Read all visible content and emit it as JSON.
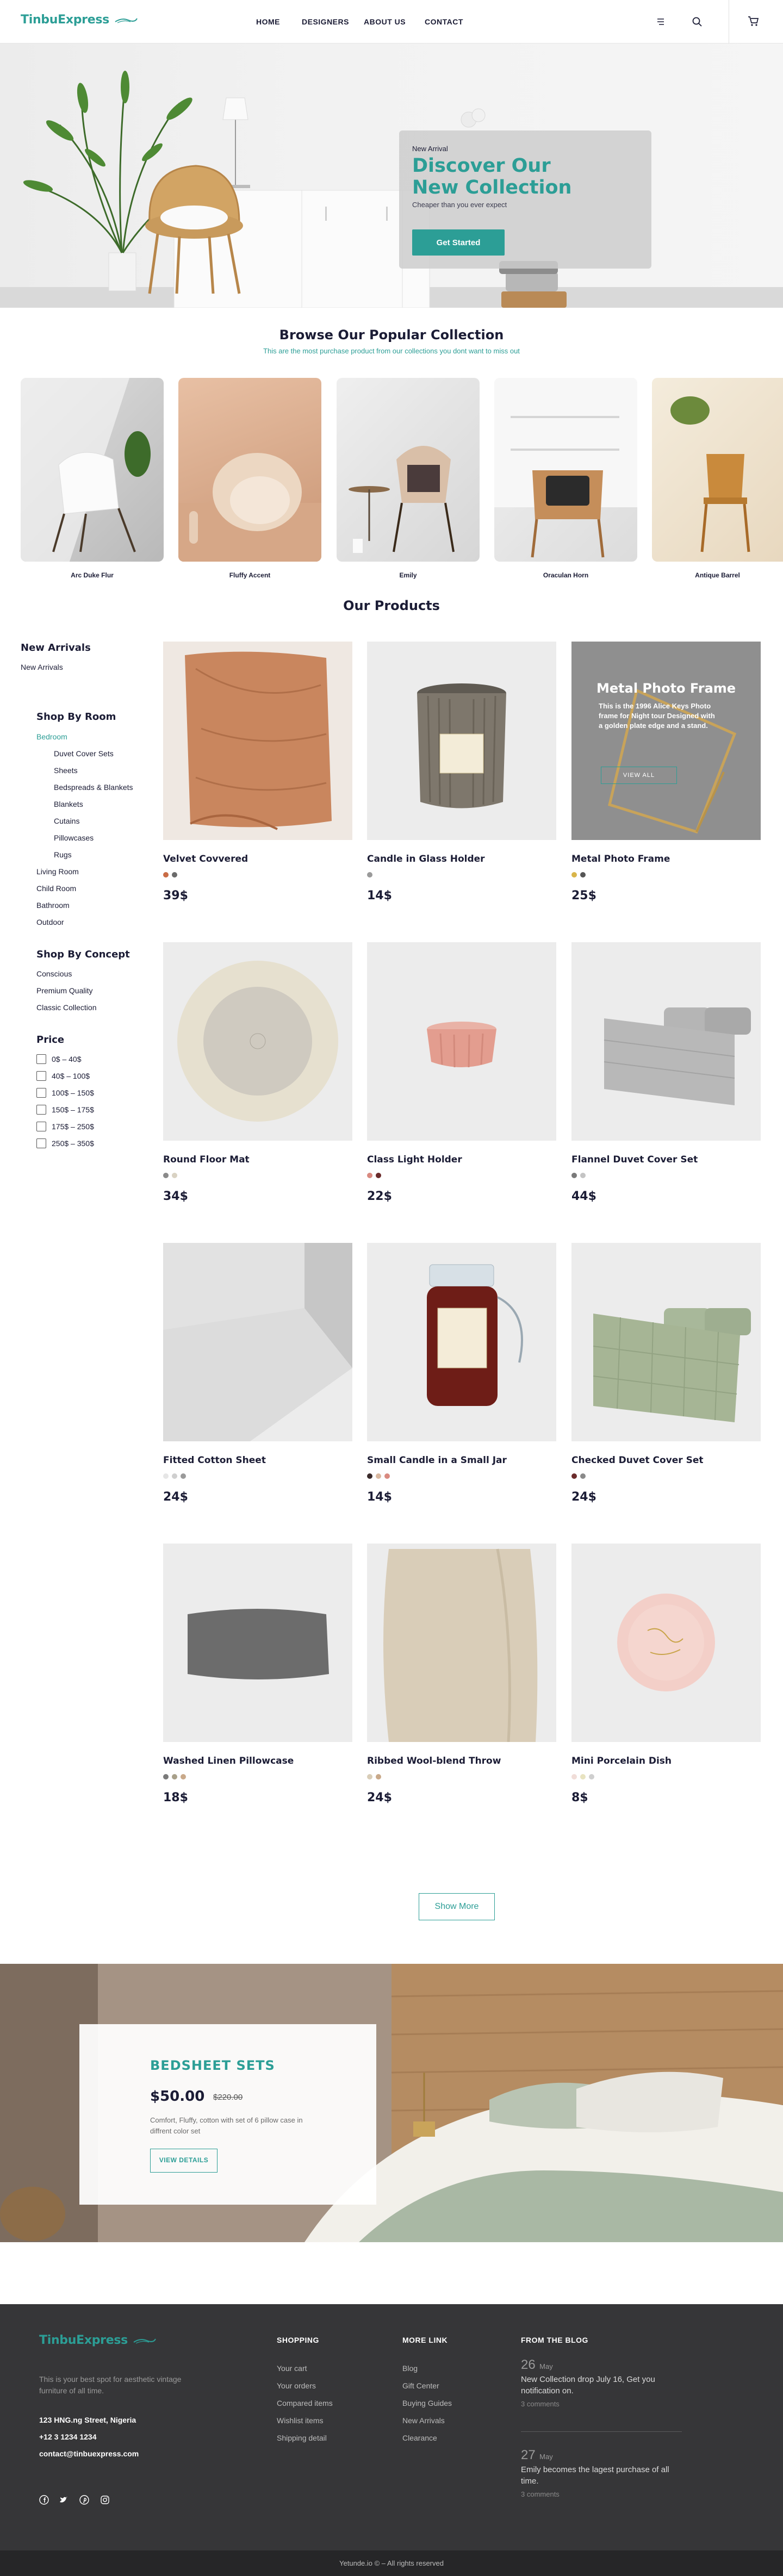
{
  "header": {
    "logo": "TinbuExpress",
    "nav": [
      "HOME",
      "DESIGNERS",
      "ABOUT US",
      "CONTACT"
    ]
  },
  "hero": {
    "kicker": "New Arrival",
    "title_line1": "Discover Our",
    "title_line2": "New Collection",
    "subtitle": "Cheaper than you ever expect",
    "cta": "Get Started"
  },
  "collection": {
    "title": "Browse Our Popular Collection",
    "subtitle": "This are the most purchase product from our collections you dont want to miss out",
    "items": [
      "Arc Duke Flur",
      "Fluffy Accent",
      "Emily",
      "Oraculan Horn",
      "Antique Barrel"
    ]
  },
  "products_title": "Our Products",
  "sidebar": {
    "new_arrivals_heading": "New Arrivals",
    "new_arrivals_link": "New Arrivals",
    "room_heading": "Shop By Room",
    "room_active": "Bedroom",
    "room_sub": [
      "Duvet Cover Sets",
      "Sheets",
      "Bedspreads & Blankets",
      "Blankets",
      "Cutains",
      "Pillowcases",
      "Rugs"
    ],
    "rooms": [
      "Living Room",
      "Child Room",
      "Bathroom",
      "Outdoor"
    ],
    "concept_heading": "Shop By Concept",
    "concepts": [
      "Conscious",
      "Premium Quality",
      "Classic Collection"
    ],
    "price_heading": "Price",
    "prices": [
      "0$ – 40$",
      "40$ – 100$",
      "100$ – 150$",
      "150$ – 175$",
      "175$ – 250$",
      "250$ – 350$"
    ]
  },
  "promo_tile": {
    "title": "Metal Photo Frame",
    "text": "This is the 1996 Alice Keys Photo frame for Night tour Designed with a golden plate edge and a stand.",
    "button": "VIEW ALL"
  },
  "products": [
    {
      "name": "Velvet Covvered",
      "price": "39$",
      "swatches": [
        "#c96c46",
        "#6b6b6b"
      ]
    },
    {
      "name": "Candle in Glass Holder",
      "price": "14$",
      "swatches": [
        "#9a9a9a"
      ]
    },
    {
      "name": "Metal Photo Frame",
      "price": "25$",
      "swatches": [
        "#d9b54a",
        "#555555"
      ]
    },
    {
      "name": "Round Floor Mat",
      "price": "34$",
      "swatches": [
        "#8a8a8a",
        "#d9d2c3"
      ]
    },
    {
      "name": "Class Light Holder",
      "price": "22$",
      "swatches": [
        "#d98a80",
        "#6b2b2b"
      ]
    },
    {
      "name": "Flannel Duvet Cover Set",
      "price": "44$",
      "swatches": [
        "#7a7a7a",
        "#c4c4c4"
      ]
    },
    {
      "name": "Fitted Cotton Sheet",
      "price": "24$",
      "swatches": [
        "#e6e6e6",
        "#cfcfcf",
        "#9a9a9a"
      ]
    },
    {
      "name": "Small Candle in a Small Jar",
      "price": "14$",
      "swatches": [
        "#3a2a2a",
        "#d9b8a0",
        "#d98a80"
      ]
    },
    {
      "name": "Checked Duvet Cover Set",
      "price": "24$",
      "swatches": [
        "#6b2b2b",
        "#8a8a8a"
      ]
    },
    {
      "name": "Washed Linen Pillowcase",
      "price": "18$",
      "swatches": [
        "#7a7a7a",
        "#a8a08a",
        "#c9a98a"
      ]
    },
    {
      "name": "Ribbed Wool-blend Throw",
      "price": "24$",
      "swatches": [
        "#d9cdb8",
        "#c9a98a"
      ]
    },
    {
      "name": "Mini Porcelain Dish",
      "price": "8$",
      "swatches": [
        "#f0ddd8",
        "#e8e3c0",
        "#cfcfcf"
      ]
    }
  ],
  "show_more": "Show More",
  "banner": {
    "title": "BEDSHEET SETS",
    "price": "$50.00",
    "old_price": "$220.00",
    "description": "Comfort, Fluffy, cotton with set of 6 pillow case in diffrent color set",
    "button": "VIEW DETAILS"
  },
  "footer": {
    "logo": "TinbuExpress",
    "tagline": "This is your best spot for aesthetic vintage furniture of all time.",
    "address": "123 HNG.ng Street, Nigeria",
    "phone": "+12 3 1234 1234",
    "email": "contact@tinbuexpress.com",
    "shopping_heading": "SHOPPING",
    "shopping": [
      "Your cart",
      "Your orders",
      "Compared items",
      "Wishlist items",
      "Shipping detail"
    ],
    "more_heading": "MORE LINK",
    "more": [
      "Blog",
      "Gift Center",
      "Buying Guides",
      "New Arrivals",
      "Clearance"
    ],
    "blog_heading": "FROM THE BLOG",
    "posts": [
      {
        "day": "26",
        "month": "May",
        "text": "New Collection drop July 16, Get you notification on.",
        "comments": "3 comments"
      },
      {
        "day": "27",
        "month": "May",
        "text": "Emily becomes the lagest purchase of all time.",
        "comments": "3 comments"
      }
    ],
    "copyright": "Yetunde.io © – All rights reserved"
  },
  "colors": {
    "accent": "#2c9e96",
    "dark": "#1b1c35",
    "footer_bg": "#363638"
  },
  "icons": [
    "menu-icon",
    "search-icon",
    "cart-icon",
    "facebook-icon",
    "twitter-icon",
    "pinterest-icon",
    "instagram-icon"
  ]
}
